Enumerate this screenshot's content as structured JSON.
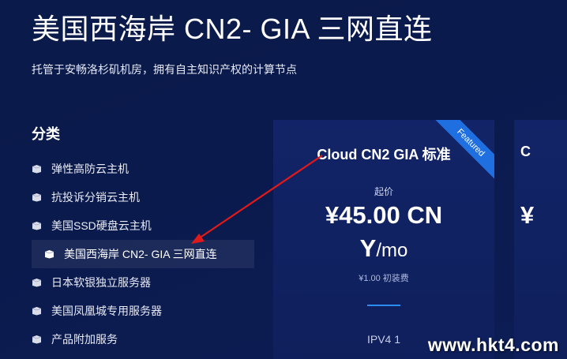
{
  "hero": {
    "title": "美国西海岸 CN2- GIA 三网直连",
    "subtitle": "托管于安畅洛杉矶机房，拥有自主知识产权的计算节点"
  },
  "sidebar": {
    "heading": "分类",
    "items": [
      {
        "label": "弹性高防云主机",
        "icon": "box-icon",
        "active": false
      },
      {
        "label": "抗投诉分销云主机",
        "icon": "box-icon",
        "active": false
      },
      {
        "label": "美国SSD硬盘云主机",
        "icon": "box-icon",
        "active": false
      },
      {
        "label": "美国西海岸 CN2- GIA 三网直连",
        "icon": "box-icon",
        "active": true
      },
      {
        "label": "日本软银独立服务器",
        "icon": "box-icon",
        "active": false
      },
      {
        "label": "美国凤凰城专用服务器",
        "icon": "box-icon",
        "active": false
      },
      {
        "label": "产品附加服务",
        "icon": "box-icon",
        "active": false
      }
    ]
  },
  "product_card": {
    "title": "Cloud CN2 GIA 标准",
    "ribbon": "Featured",
    "price_caption": "起价",
    "price_line1": "¥45.00 CN",
    "price_line2": "Y",
    "period": "/mo",
    "setup_fee": "¥1.00 初装费",
    "feature": "IPV4 1"
  },
  "next_card": {
    "title": "C",
    "price": "¥"
  },
  "watermark": "www.hkt4.com",
  "colors": {
    "background": "#0b1a4c",
    "card": "#122467",
    "ribbon": "#1f6fe0",
    "divider": "#2d8cf0",
    "annotation_arrow": "#e01a1a"
  }
}
